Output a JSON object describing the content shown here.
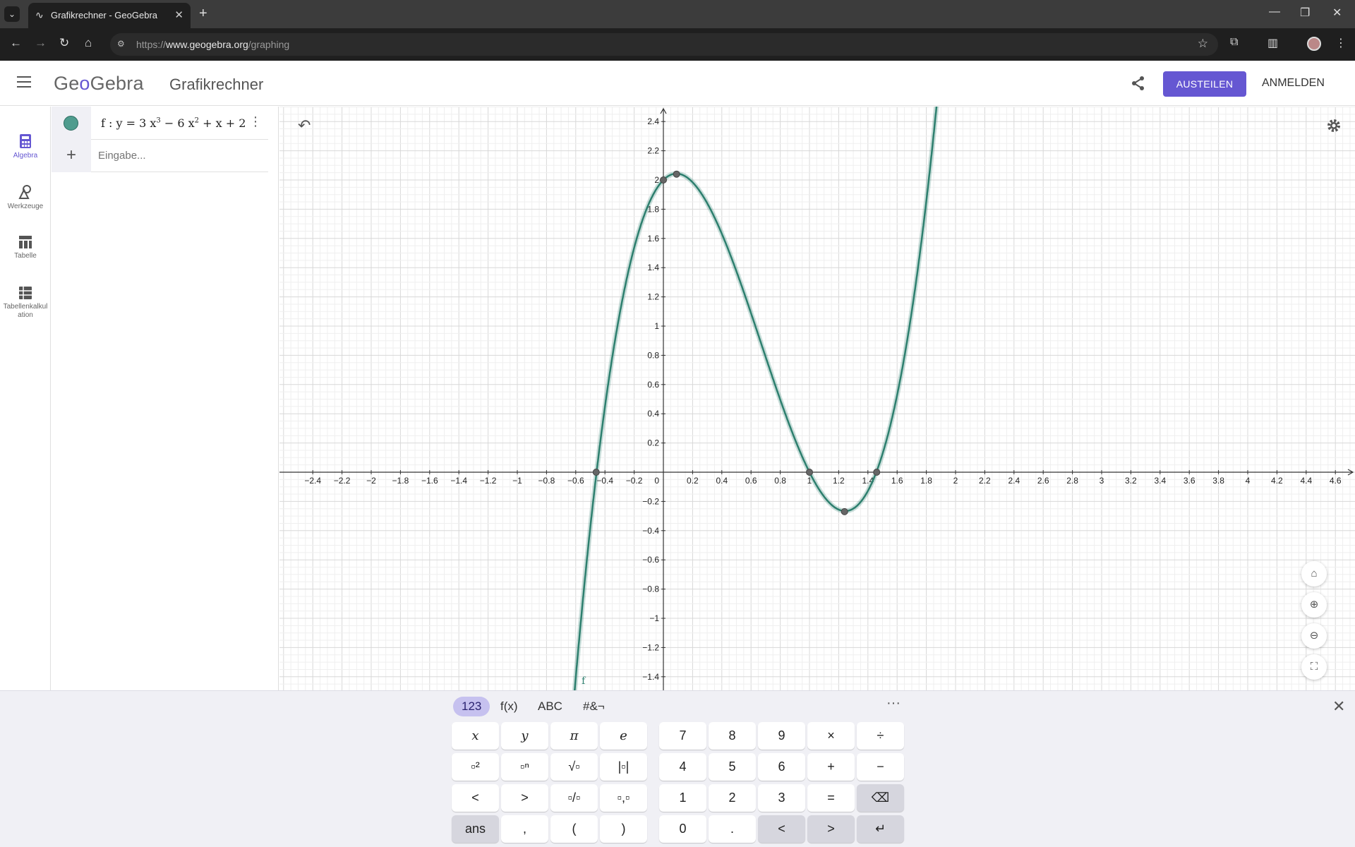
{
  "browser": {
    "tab_title": "Grafikrechner - GeoGebra",
    "url_prefix": "https://",
    "url_host": "www.geogebra.org",
    "url_path": "/graphing"
  },
  "header": {
    "logo_pre": "Ge",
    "logo_o": "o",
    "logo_post": "Gebra",
    "title": "Grafikrechner",
    "share_label": "AUSTEILEN",
    "login_label": "ANMELDEN",
    "accent_color": "#6557d2"
  },
  "rail": {
    "items": [
      {
        "label": "Algebra",
        "icon": "calculator-icon"
      },
      {
        "label": "Werkzeuge",
        "icon": "tools-icon"
      },
      {
        "label": "Tabelle",
        "icon": "table-icon"
      },
      {
        "label": "Tabellenkalkulation",
        "icon": "spreadsheet-icon"
      }
    ]
  },
  "algebra": {
    "function": {
      "name": "f",
      "sep": " : ",
      "y": "y = 3 x",
      "exp1": "3",
      "mid": " − 6 x",
      "exp2": "2",
      "tail": " + x + 2",
      "color": "#2d7f6e"
    },
    "input_placeholder": "Eingabe..."
  },
  "graph": {
    "x_ticks": [
      "−2.4",
      "−2.2",
      "−2",
      "−1.8",
      "−1.6",
      "−1.4",
      "−1.2",
      "−1",
      "−0.8",
      "−0.6",
      "−0.4",
      "−0.2",
      "0",
      "0.2",
      "0.4",
      "0.6",
      "0.8",
      "1",
      "1.2",
      "1.4",
      "1.6",
      "1.8",
      "2",
      "2.2",
      "2.4",
      "2.6",
      "2.8",
      "3",
      "3.2",
      "3.4",
      "3.6",
      "3.8",
      "4",
      "4.2",
      "4.4",
      "4.6"
    ],
    "y_ticks": [
      "2.4",
      "2.2",
      "2",
      "1.8",
      "1.6",
      "1.4",
      "1.2",
      "1",
      "0.8",
      "0.6",
      "0.4",
      "0.2",
      "−0.2",
      "−0.4",
      "−0.6",
      "−0.8",
      "−1",
      "−1.2",
      "−1.4"
    ],
    "curve_label": "f",
    "xlim": [
      -2.9,
      4.7
    ],
    "ylim": [
      -1.5,
      2.5
    ],
    "coefficients": [
      3,
      -6,
      1,
      2
    ],
    "special_points": [
      {
        "x": -0.46,
        "y": 0
      },
      {
        "x": 0.09,
        "y": 2.04
      },
      {
        "x": 1,
        "y": 0
      },
      {
        "x": 1.24,
        "y": -0.27
      },
      {
        "x": 1.46,
        "y": 0
      },
      {
        "x": 0,
        "y": 2
      }
    ]
  },
  "keyboard": {
    "tabs": [
      "123",
      "f(x)",
      "ABC",
      "#&¬"
    ],
    "more": "···",
    "close": "✕",
    "left_keys": [
      [
        "x",
        "y",
        "π",
        "e"
      ],
      [
        "▫²",
        "▫ⁿ",
        "√▫",
        "|▫|"
      ],
      [
        "<",
        ">",
        "▫/▫",
        "▫,▫"
      ],
      [
        "ans",
        ",",
        "(",
        ")"
      ]
    ],
    "right_keys": [
      [
        "7",
        "8",
        "9",
        "×",
        "÷"
      ],
      [
        "4",
        "5",
        "6",
        "+",
        "−"
      ],
      [
        "1",
        "2",
        "3",
        "=",
        "⌫"
      ],
      [
        "0",
        ".",
        "<",
        ">",
        "↵"
      ]
    ]
  }
}
